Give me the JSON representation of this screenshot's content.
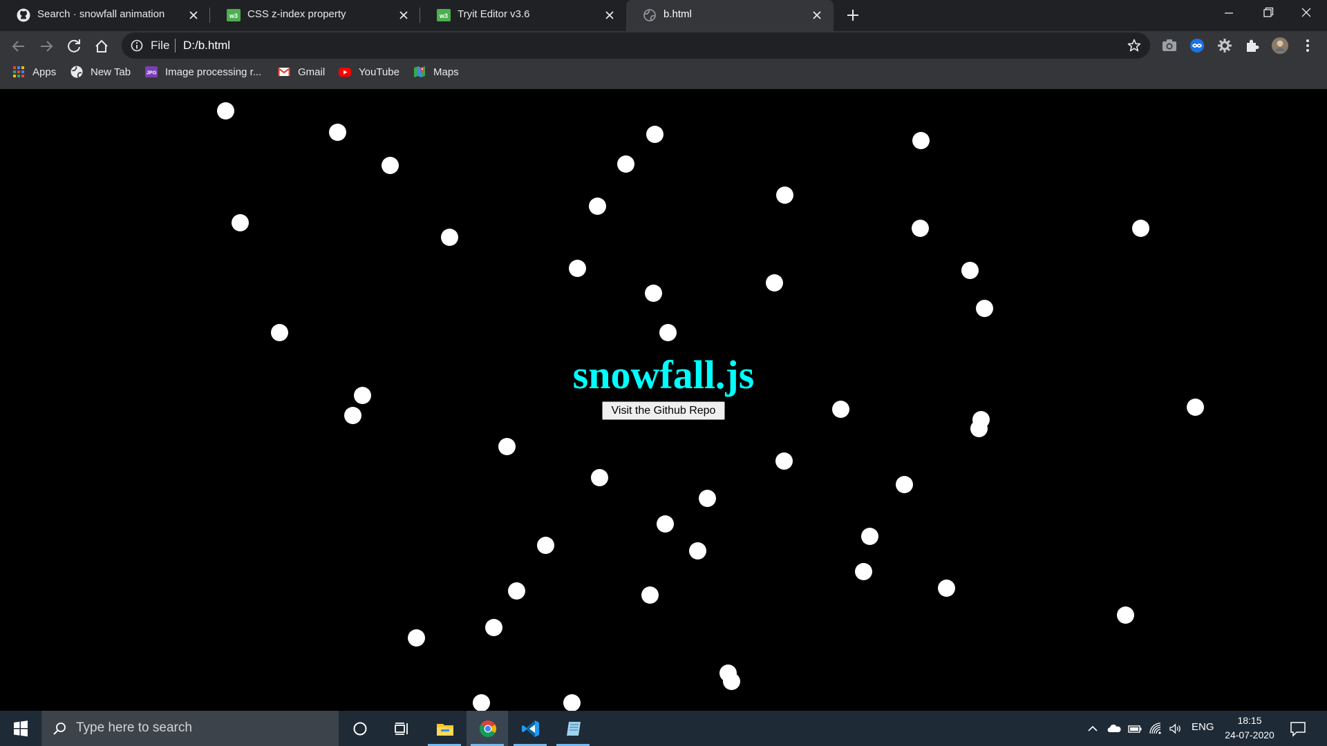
{
  "browser": {
    "tabs": [
      {
        "title": "Search · snowfall animation",
        "favicon": "github-icon",
        "active": false
      },
      {
        "title": "CSS z-index property",
        "favicon": "w3schools-icon",
        "active": false
      },
      {
        "title": "Tryit Editor v3.6",
        "favicon": "w3schools-icon",
        "active": false
      },
      {
        "title": "b.html",
        "favicon": "globe-icon",
        "active": true
      }
    ],
    "address_bar": {
      "scheme_label": "File",
      "url": "D:/b.html"
    },
    "bookmarks": [
      {
        "label": "Apps",
        "icon": "apps-grid-icon"
      },
      {
        "label": "New Tab",
        "icon": "globe-icon"
      },
      {
        "label": "Image processing r...",
        "icon": "jpg-icon"
      },
      {
        "label": "Gmail",
        "icon": "gmail-icon"
      },
      {
        "label": "YouTube",
        "icon": "youtube-icon"
      },
      {
        "label": "Maps",
        "icon": "maps-icon"
      }
    ]
  },
  "page": {
    "heading": "snowfall.js",
    "button_label": "Visit the Github Repo",
    "heading_color": "#00ffff",
    "background_color": "#000000",
    "snowflake_color": "#ffffff"
  },
  "taskbar": {
    "search_placeholder": "Type here to search",
    "language": "ENG",
    "time": "18:15",
    "date": "24-07-2020"
  }
}
